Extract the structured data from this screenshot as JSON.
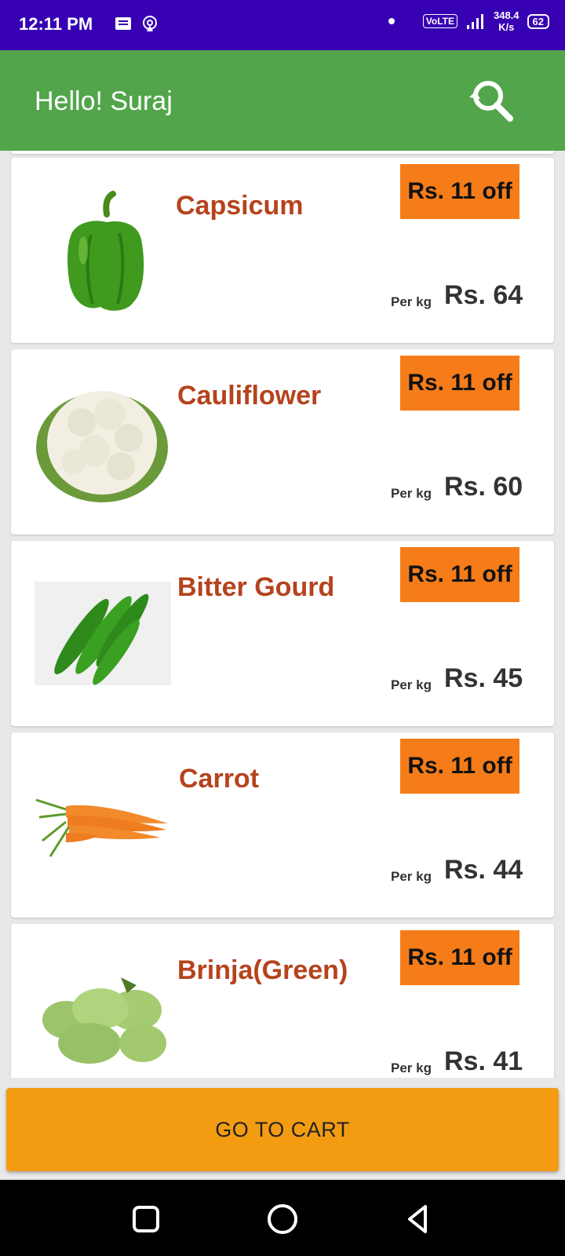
{
  "status_bar": {
    "time": "12:11 PM",
    "volte": "VoLTE",
    "net_speed_value": "348.4",
    "net_speed_unit": "K/s",
    "battery": "62"
  },
  "app_bar": {
    "title": "Hello! Suraj",
    "search_icon": "search-refresh-icon"
  },
  "products": [
    {
      "name": "Capsicum",
      "offer": "Rs. 11 off",
      "unit": "Per kg",
      "price": "Rs. 64",
      "image": "capsicum"
    },
    {
      "name": "Cauliflower",
      "offer": "Rs. 11 off",
      "unit": "Per kg",
      "price": "Rs. 60",
      "image": "cauliflower"
    },
    {
      "name": "Bitter Gourd",
      "offer": "Rs. 11 off",
      "unit": "Per kg",
      "price": "Rs. 45",
      "image": "bitter-gourd"
    },
    {
      "name": "Carrot",
      "offer": "Rs. 11 off",
      "unit": "Per kg",
      "price": "Rs. 44",
      "image": "carrot"
    },
    {
      "name": "Brinja(Green)",
      "offer": "Rs. 11 off",
      "unit": "Per kg",
      "price": "Rs. 41",
      "image": "brinjal"
    }
  ],
  "cart_button": {
    "label": "GO TO CART"
  },
  "colors": {
    "status_bar": "#3700b3",
    "app_bar": "#52a54a",
    "offer_badge": "#f57c19",
    "product_name": "#b5431d",
    "cart_button": "#f39c12"
  }
}
